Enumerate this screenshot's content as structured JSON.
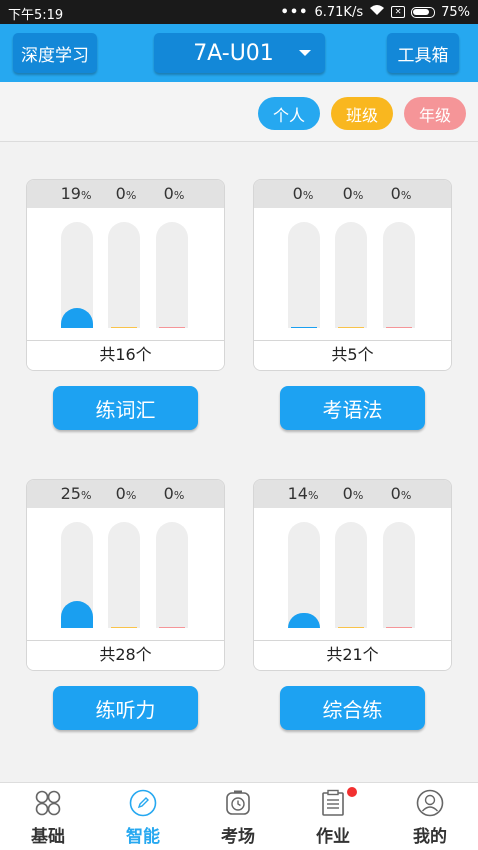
{
  "status_bar": {
    "time": "下午5:19",
    "speed": "6.71K/s",
    "battery": "75%"
  },
  "header": {
    "left_button": "深度学习",
    "selector": "7A-U01",
    "right_button": "工具箱"
  },
  "filters": [
    {
      "label": "个人",
      "color": "#26a8f0"
    },
    {
      "label": "班级",
      "color": "#f9b71f"
    },
    {
      "label": "年级",
      "color": "#f59598"
    }
  ],
  "percent_unit": "%",
  "bar_colors": [
    "#1a9ff0",
    "#f9c34a",
    "#f59598"
  ],
  "cards": [
    {
      "values": [
        19,
        0,
        0
      ],
      "p": [
        "19",
        "0",
        "0"
      ],
      "total": "共16个",
      "action": "练词汇"
    },
    {
      "values": [
        0,
        0,
        0
      ],
      "p": [
        "0",
        "0",
        "0"
      ],
      "total": "共5个",
      "action": "考语法"
    },
    {
      "values": [
        25,
        0,
        0
      ],
      "p": [
        "25",
        "0",
        "0"
      ],
      "total": "共28个",
      "action": "练听力"
    },
    {
      "values": [
        14,
        0,
        0
      ],
      "p": [
        "14",
        "0",
        "0"
      ],
      "total": "共21个",
      "action": "综合练"
    }
  ],
  "tabs": [
    {
      "label": "基础",
      "icon": "grid-icon",
      "active": false
    },
    {
      "label": "智能",
      "icon": "pencil-icon",
      "active": true
    },
    {
      "label": "考场",
      "icon": "clock-icon",
      "active": false
    },
    {
      "label": "作业",
      "icon": "clipboard-icon",
      "active": false,
      "badge": true
    },
    {
      "label": "我的",
      "icon": "user-icon",
      "active": false
    }
  ]
}
